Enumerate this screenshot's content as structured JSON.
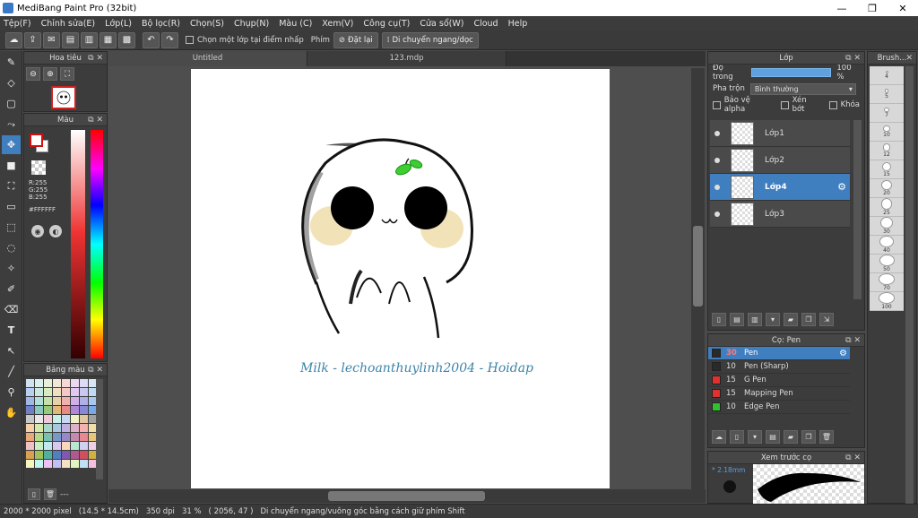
{
  "window": {
    "title": "MediBang Paint Pro (32bit)",
    "minimize": "—",
    "maximize": "❐",
    "close": "✕"
  },
  "menu": [
    "Tệp(F)",
    "Chỉnh sửa(E)",
    "Lớp(L)",
    "Bộ lọc(R)",
    "Chọn(S)",
    "Chụp(N)",
    "Màu (C)",
    "Xem(V)",
    "Công cụ(T)",
    "Cửa sổ(W)",
    "Cloud",
    "Help"
  ],
  "toolbar": {
    "select_layer_check": "Chọn một lớp tại điểm nhấp",
    "key_label": "Phím",
    "reset_label": "Đặt lại",
    "move_label": "Di chuyển ngang/dọc"
  },
  "navigator": {
    "title": "Hoa tiêu"
  },
  "color_panel": {
    "title": "Màu",
    "r": "R:255",
    "g": "G:255",
    "b": "B:255",
    "hex": "#FFFFFF"
  },
  "palette": {
    "title": "Bảng màu",
    "colors": [
      "#cfe3ef",
      "#d9f0ef",
      "#e8f0d8",
      "#f0e8d8",
      "#f5d8d8",
      "#ecd8f0",
      "#dcdcf5",
      "#d8e8f5",
      "#b8d0f0",
      "#c8e8e0",
      "#d8ecc0",
      "#f0e0c0",
      "#f5c8c8",
      "#e0c8f0",
      "#c8c8f0",
      "#c0dcf5",
      "#a0b8e8",
      "#b0e0d8",
      "#c8e0a8",
      "#e8d0a8",
      "#f0b0b0",
      "#d0b0e8",
      "#b0b0e8",
      "#a8c8f0",
      "#6e80c8",
      "#88c8c0",
      "#98c878",
      "#e0b878",
      "#e88888",
      "#b088d8",
      "#8888d8",
      "#78a8e8",
      "#c8c8c8",
      "#e8e8e8",
      "#f0c8d8",
      "#c8f0e8",
      "#c8d8f0",
      "#f0f0c8",
      "#e0c8a0",
      "#a0a0a0",
      "#f5d0a8",
      "#d8e8a8",
      "#a8d8c8",
      "#a8c8e0",
      "#c0b0e0",
      "#e0b0c8",
      "#f5b0b0",
      "#f0e0a8",
      "#e8a878",
      "#b8d888",
      "#78c0b0",
      "#7898c8",
      "#9888c8",
      "#c888b0",
      "#e88890",
      "#e8c878",
      "#f0c0c8",
      "#c8f0c0",
      "#c0e8f0",
      "#d8c8f0",
      "#f8d8b8",
      "#b8e8d0",
      "#d0d0f0",
      "#f0d0e8",
      "#d8a050",
      "#a0c058",
      "#50b0a0",
      "#5080c0",
      "#8058b0",
      "#b05890",
      "#d05060",
      "#d0b040",
      "#f5f5c0",
      "#c0f5f0",
      "#f0c0f0",
      "#c0c0f5",
      "#f5e0c0",
      "#e0f5c0",
      "#c0e0f5",
      "#f5c0e0"
    ],
    "more": "---"
  },
  "document": {
    "tabs": [
      "Untitled",
      "123.mdp"
    ],
    "signature": "Milk - lechoanthuylinh2004 - Hoidap"
  },
  "layer_panel": {
    "title": "Lớp",
    "opacity_label": "Độ trong",
    "opacity_value": "100 %",
    "opacity": 1.0,
    "blend_label": "Pha trộn",
    "blend_value": "Bình thường",
    "protect_alpha": "Bảo vệ alpha",
    "clipping": "Xén bớt",
    "lock": "Khóa",
    "layers": [
      {
        "name": "Lớp1",
        "active": false
      },
      {
        "name": "Lớp2",
        "active": false
      },
      {
        "name": "Lớp4",
        "active": true
      },
      {
        "name": "Lớp3",
        "active": false
      }
    ]
  },
  "brush_panel": {
    "title": "Cọ: Pen",
    "brushes": [
      {
        "size": "30",
        "name": "Pen",
        "color": "#2a2a2a",
        "active": true
      },
      {
        "size": "10",
        "name": "Pen (Sharp)",
        "color": "#2a2a2a",
        "active": false
      },
      {
        "size": "15",
        "name": "G Pen",
        "color": "#e03030",
        "active": false
      },
      {
        "size": "15",
        "name": "Mapping Pen",
        "color": "#e03030",
        "active": false
      },
      {
        "size": "10",
        "name": "Edge Pen",
        "color": "#30c030",
        "active": false
      }
    ]
  },
  "preview_panel": {
    "title": "Xem trước cọ",
    "size": "* 2.18mm"
  },
  "brush_size_panel": {
    "title": "Brush...",
    "sizes": [
      "4",
      "5",
      "7",
      "10",
      "12",
      "15",
      "20",
      "25",
      "30",
      "40",
      "50",
      "70",
      "100"
    ]
  },
  "status": {
    "dims": "2000 * 2000 pixel",
    "cm": "(14.5 * 14.5cm)",
    "dpi": "350 dpi",
    "zoom": "31 %",
    "coords": "( 2056, 47 )",
    "hint": "Di chuyển ngang/vuông góc bằng cách giữ phím Shift"
  }
}
